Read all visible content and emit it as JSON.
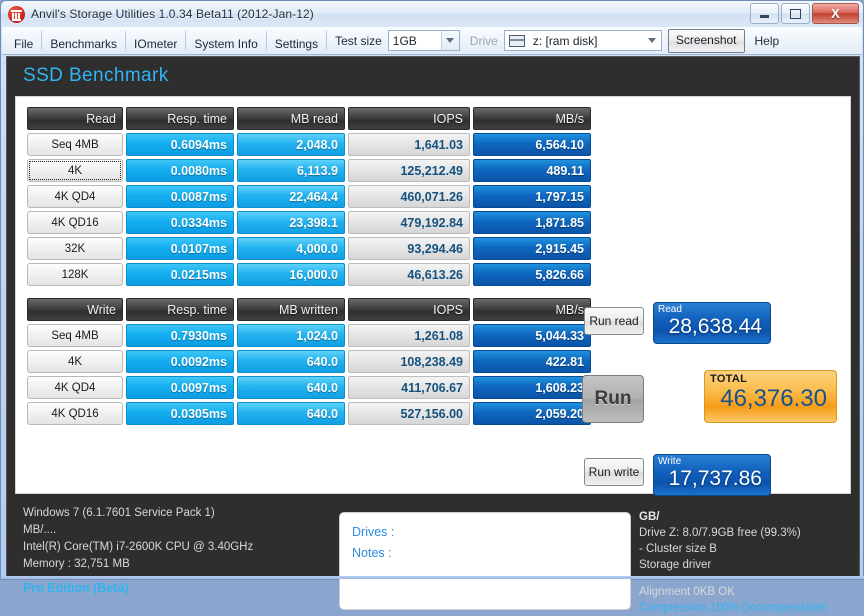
{
  "window": {
    "title": "Anvil's Storage Utilities 1.0.34 Beta11 (2012-Jan-12)",
    "app_icon": "anvil-icon",
    "minimize_label": "",
    "maximize_label": "",
    "close_label": "X"
  },
  "menubar": {
    "items": [
      "File",
      "Benchmarks",
      "IOmeter",
      "System Info",
      "Settings"
    ],
    "test_size_label": "Test size",
    "test_size_value": "1GB",
    "drive_label": "Drive",
    "drive_value": "z: [ram disk]",
    "screenshot_label": "Screenshot",
    "help_label": "Help"
  },
  "page": {
    "title": "SSD Benchmark",
    "title_color": "#31b4f2"
  },
  "read_table": {
    "headers": [
      "Read",
      "Resp. time",
      "MB read",
      "IOPS",
      "MB/s"
    ],
    "rows": [
      {
        "label": "Seq 4MB",
        "focused": false,
        "resp": "0.6094ms",
        "mb": "2,048.0",
        "iops": "1,641.03",
        "mbs": "6,564.10"
      },
      {
        "label": "4K",
        "focused": true,
        "resp": "0.0080ms",
        "mb": "6,113.9",
        "iops": "125,212.49",
        "mbs": "489.11"
      },
      {
        "label": "4K QD4",
        "focused": false,
        "resp": "0.0087ms",
        "mb": "22,464.4",
        "iops": "460,071.26",
        "mbs": "1,797.15"
      },
      {
        "label": "4K QD16",
        "focused": false,
        "resp": "0.0334ms",
        "mb": "23,398.1",
        "iops": "479,192.84",
        "mbs": "1,871.85"
      },
      {
        "label": "32K",
        "focused": false,
        "resp": "0.0107ms",
        "mb": "4,000.0",
        "iops": "93,294.46",
        "mbs": "2,915.45"
      },
      {
        "label": "128K",
        "focused": false,
        "resp": "0.0215ms",
        "mb": "16,000.0",
        "iops": "46,613.26",
        "mbs": "5,826.66"
      }
    ]
  },
  "write_table": {
    "headers": [
      "Write",
      "Resp. time",
      "MB written",
      "IOPS",
      "MB/s"
    ],
    "rows": [
      {
        "label": "Seq 4MB",
        "focused": false,
        "resp": "0.7930ms",
        "mb": "1,024.0",
        "iops": "1,261.08",
        "mbs": "5,044.33"
      },
      {
        "label": "4K",
        "focused": false,
        "resp": "0.0092ms",
        "mb": "640.0",
        "iops": "108,238.49",
        "mbs": "422.81"
      },
      {
        "label": "4K QD4",
        "focused": false,
        "resp": "0.0097ms",
        "mb": "640.0",
        "iops": "411,706.67",
        "mbs": "1,608.23"
      },
      {
        "label": "4K QD16",
        "focused": false,
        "resp": "0.0305ms",
        "mb": "640.0",
        "iops": "527,156.00",
        "mbs": "2,059.20"
      }
    ]
  },
  "controls": {
    "run_read_label": "Run read",
    "run_label": "Run",
    "run_write_label": "Run write"
  },
  "scores": {
    "read_label": "Read",
    "read_value": "28,638.44",
    "total_label": "TOTAL",
    "total_value": "46,376.30",
    "write_label": "Write",
    "write_value": "17,737.86",
    "badge_color": "#0b53ad",
    "total_color": "#f79d17"
  },
  "system_info": {
    "os": "Windows 7 (6.1.7601 Service Pack 1)",
    "units": "MB/....",
    "cpu": "Intel(R) Core(TM) i7-2600K CPU @ 3.40GHz",
    "memory": "Memory : 32,751 MB",
    "edition": "Pro Edition (Beta)"
  },
  "notes": {
    "drives_label": "Drives :",
    "notes_label": "Notes :"
  },
  "drive_info": {
    "units": "GB/",
    "drive_line": "Drive Z: 8.0/7.9GB free (99.3%)",
    "cluster": " - Cluster size B",
    "driver": "Storage driver",
    "alignment": "Alignment 0KB OK",
    "compression": "Compression 100% (Incompressible)"
  }
}
